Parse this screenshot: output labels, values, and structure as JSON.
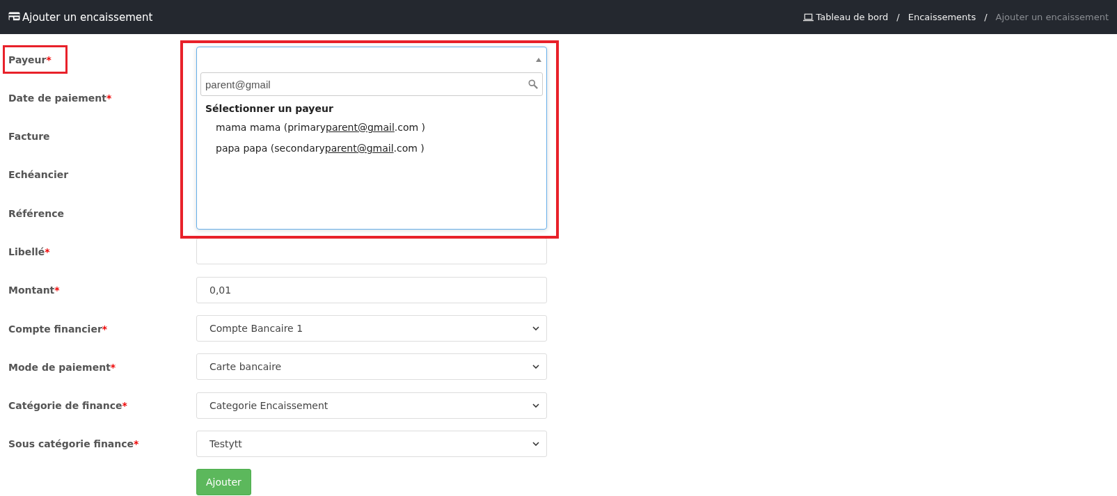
{
  "header": {
    "title": "Ajouter un encaissement",
    "breadcrumb": [
      {
        "label": "Tableau de bord",
        "kind": "home"
      },
      {
        "separator": "/",
        "label": "Encaissements",
        "kind": "link"
      },
      {
        "separator": "/",
        "label": "Ajouter un encaissement",
        "kind": "current"
      }
    ]
  },
  "form": {
    "fields": [
      {
        "label": "Payeur",
        "required_mark": "*",
        "kind": "covered",
        "highlighted": true
      },
      {
        "label": "Date de paiement",
        "required_mark": "*",
        "kind": "covered",
        "highlighted": false
      },
      {
        "label": "Facture",
        "kind": "covered",
        "highlighted": false
      },
      {
        "label": "Echéancier",
        "kind": "covered",
        "highlighted": false
      },
      {
        "label": "Référence",
        "kind": "covered",
        "highlighted": false
      },
      {
        "label": "Libellé",
        "required_mark": "*",
        "kind": "text",
        "highlighted": false
      },
      {
        "label": "Montant",
        "required_mark": "*",
        "kind": "text",
        "value": "0,01",
        "highlighted": false
      },
      {
        "label": "Compte financier",
        "required_mark": "*",
        "kind": "select",
        "value": "Compte Bancaire 1",
        "highlighted": false
      },
      {
        "label": "Mode de paiement",
        "required_mark": "*",
        "kind": "select",
        "value": "Carte bancaire",
        "highlighted": false
      },
      {
        "label": "Catégorie de finance",
        "required_mark": "*",
        "kind": "select",
        "value": "Categorie Encaissement",
        "highlighted": false
      },
      {
        "label": "Sous catégorie finance",
        "required_mark": "*",
        "kind": "select",
        "value": "Testytt",
        "highlighted": false
      }
    ],
    "submit": "Ajouter"
  },
  "payer_dropdown": {
    "expanded": true,
    "highlighted": true,
    "search": "parent@gmail",
    "group": "Sélectionner un payeur",
    "options": [
      {
        "before": "mama mama (primary",
        "match": "parent@gmail",
        "after": ".com )"
      },
      {
        "before": "papa papa (secondary",
        "match": "parent@gmail",
        "after": ".com )"
      }
    ]
  }
}
